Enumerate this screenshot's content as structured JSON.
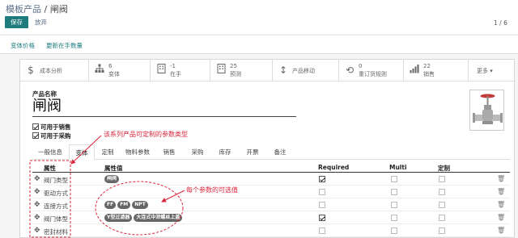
{
  "breadcrumb": {
    "parent": "模板产品",
    "separator": " / ",
    "current": "闸阀"
  },
  "toolbar": {
    "save_label": "保存",
    "discard_label": "放弃"
  },
  "pager": {
    "value": "1 / 6"
  },
  "actions": {
    "variant_prices": "变体价格",
    "update_qty": "更新在手数量"
  },
  "stats": {
    "cost_analysis": "成本分析",
    "variants_count": "6",
    "variants_label": "变体",
    "onhand_count": "-1",
    "onhand_label": "在手",
    "forecast_count": "25",
    "forecast_label": "预测",
    "moves_label": "产品移动",
    "reorder_count": "0",
    "reorder_label": "重订货规则",
    "sales_count": "22",
    "sales_label": "销售",
    "more_label": "更多 ▾"
  },
  "form": {
    "name_label": "产品名称",
    "name_value": "闸阀",
    "can_be_sold": "可用于销售",
    "can_be_purchased": "可用于采购"
  },
  "tabs": [
    "一般信息",
    "变体",
    "定制",
    "物料参数",
    "销售",
    "采购",
    "库存",
    "开票",
    "备注"
  ],
  "active_tab": "变体",
  "table": {
    "headers": {
      "attribute": "属性",
      "values": "属性值",
      "required": "Required",
      "multi": "Multi",
      "custom": "定制"
    },
    "rows": [
      {
        "name": "阀门类型",
        "values": [
          "闸阀"
        ],
        "required": true
      },
      {
        "name": "驱动方式",
        "values": [],
        "required": false
      },
      {
        "name": "连接方式",
        "values": [
          "FF",
          "FM",
          "NPT"
        ],
        "required": false
      },
      {
        "name": "阀门体型",
        "values": [
          "Y型过滤器",
          "大连式中泄螺丝上盖"
        ],
        "required": true
      },
      {
        "name": "密封材料",
        "values": [],
        "required": false
      }
    ]
  },
  "annotations": {
    "note1": "该系列产品可定制的参数类型",
    "note2": "每个参数的可选值"
  },
  "colors": {
    "primary": "#1e7c7e",
    "annotation": "#d8253c"
  }
}
